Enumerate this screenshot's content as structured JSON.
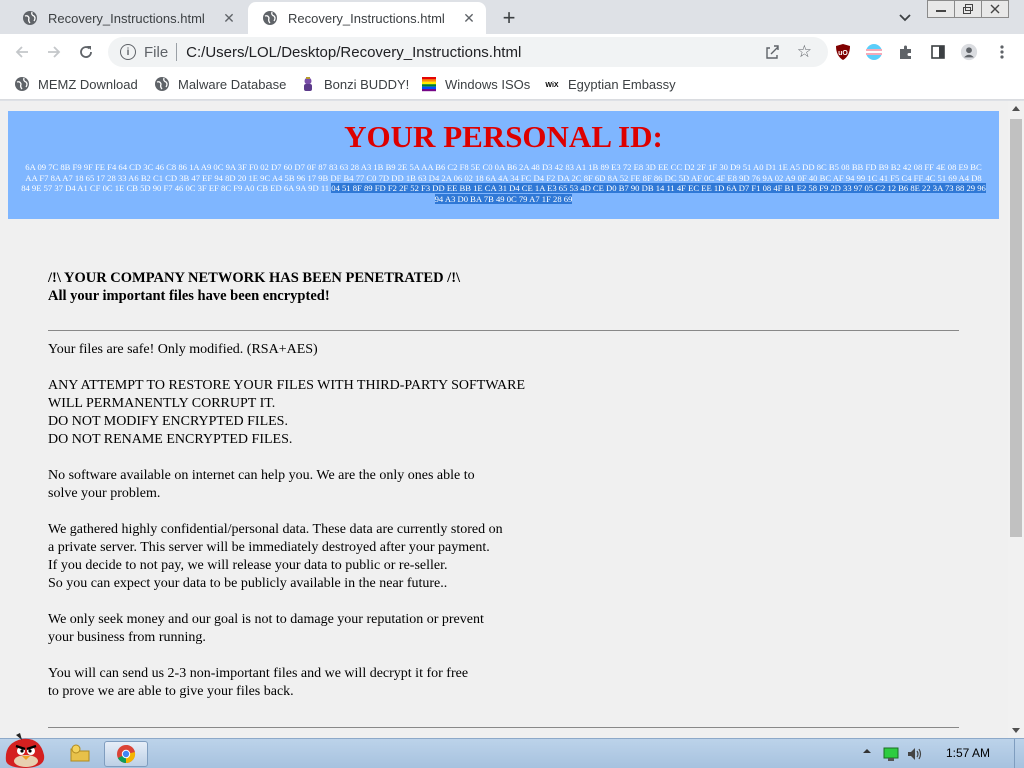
{
  "browser": {
    "tabs": [
      {
        "title": "Recovery_Instructions.html",
        "active": false
      },
      {
        "title": "Recovery_Instructions.html",
        "active": true
      }
    ],
    "new_tab_symbol": "+",
    "omnibox": {
      "scheme": "File",
      "url": "C:/Users/LOL/Desktop/Recovery_Instructions.html"
    },
    "bookmarks": [
      {
        "label": "MEMZ Download",
        "icon": "globe-icon"
      },
      {
        "label": "Malware Database",
        "icon": "globe-icon"
      },
      {
        "label": "Bonzi BUDDY!",
        "icon": "bonzi-icon"
      },
      {
        "label": "Windows ISOs",
        "icon": "windows-flag-icon"
      },
      {
        "label": "Egyptian Embassy",
        "icon": "wix-icon"
      }
    ]
  },
  "page": {
    "heading": "YOUR PERSONAL ID:",
    "id_hex_plain": "6A 09 7C 8B F9 9F FE F4 64 CD 3C 46 C8 86 1A A9 0C 9A 3F F0 02 D7 60 D7 0F 87 83 63 28 A3 1B B9 2E 5A AA B6 C2 F8 5E C0 0A B6 2A 48 D3 42 83 A1 1B 89 E3 72 E8 3D EE CC D2 2F 1F 30 D9 51 A0 D1 1E A5 DD 8C B5 08 BB FD B9 B2 42 08 FF 4E 08 E9 BC AA F7 8A A7 18 65 17 28 33 A6 B2 C1 CD 3B 47 EF 94 8D 20 1E 9C A4 5B 96 17 9B DF B4 77 C0 7D DD 1B 63 D4 2A 06 02 18 6A 4A 34 FC D4 F2 DA 2C 8F 6D 8A 52 FE 8F 86 DC 5D AF 0C 4F E8 9D 76 9A 02 A9 0F 40 BC AF 94 99 1C 41 F5 C4 FF 4C 51 69 A4 D8 84 9E 57 37 D4 A1 CF 0C 1E CB 5D 90 F7 46 0C 3F EF 8C F9 A0 CB ED 6A 9A 9D 11",
    "id_hex_selected": "04 51 8F 89 FD F2 2F 52 F3 DD EE BB 1E CA 31 D4 CE 1A E3 65 53 4D CE D0 B7 90 DB 14 11 4F EC EE 1D 6A D7 F1 08 4F B1 E2 58 F9 2D 33 97 05 C2 12 B6 8E 22 3A 73 88 29 96 94 A3 D0 BA 7B 49 0C 79 A7 1F 28 69",
    "alert_line1": "/!\\ YOUR COMPANY NETWORK HAS BEEN PENETRATED /!\\",
    "alert_line2": "All your important files have been encrypted!",
    "paragraphs": [
      "Your files are safe! Only modified. (RSA+AES)",
      "ANY ATTEMPT TO RESTORE YOUR FILES WITH THIRD-PARTY SOFTWARE\nWILL PERMANENTLY CORRUPT IT.\nDO NOT MODIFY ENCRYPTED FILES.\nDO NOT RENAME ENCRYPTED FILES.",
      "No software available on internet can help you. We are the only ones able to\nsolve your problem.",
      "We gathered highly confidential/personal data. These data are currently stored on\na private server. This server will be immediately destroyed after your payment.\nIf you decide to not pay, we will release your data to public or re-seller.\nSo you can expect your data to be publicly available in the near future..",
      "We only seek money and our goal is not to damage your reputation or prevent\nyour business from running.",
      "You will can send us 2-3 non-important files and we will decrypt it for free\nto prove we are able to give your files back."
    ]
  },
  "taskbar": {
    "clock": "1:57 AM"
  },
  "colors": {
    "id_box_bg": "#7fb6ff",
    "heading_red": "#dd0000",
    "selection_blue": "#2f78d6",
    "page_bg": "#f0f0f0"
  }
}
